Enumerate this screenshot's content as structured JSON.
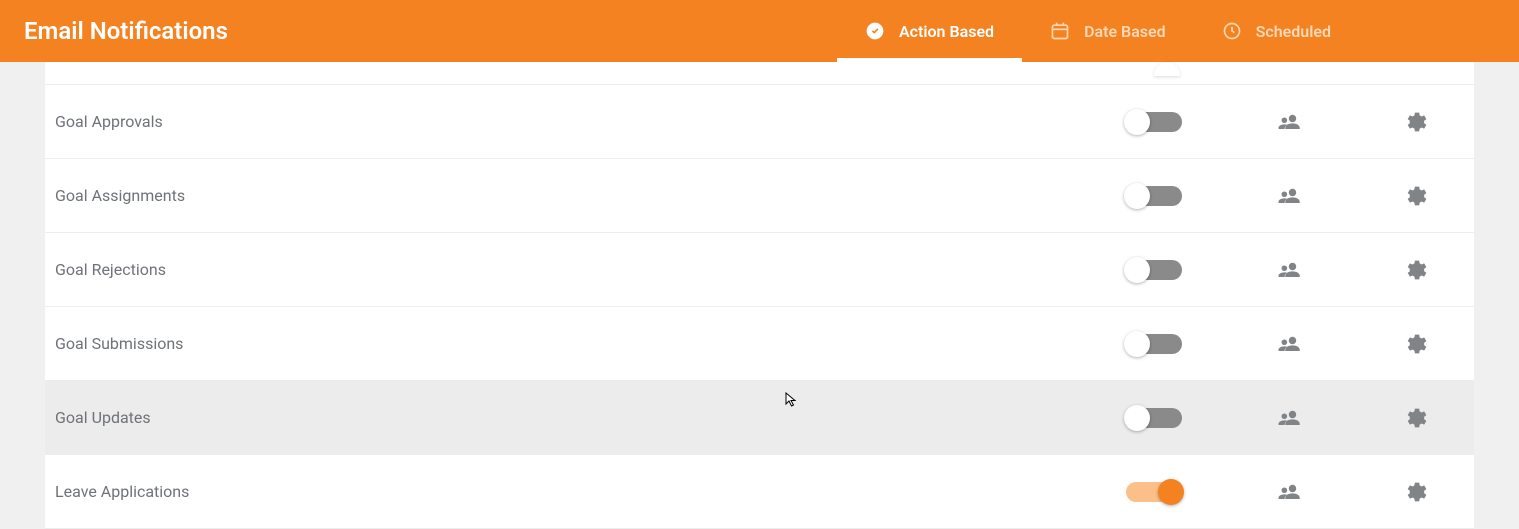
{
  "header": {
    "title": "Email Notifications"
  },
  "tabs": [
    {
      "label": "Action Based",
      "icon": "check-circle",
      "active": true
    },
    {
      "label": "Date Based",
      "icon": "calendar",
      "active": false
    },
    {
      "label": "Scheduled",
      "icon": "clock",
      "active": false
    }
  ],
  "rows": [
    {
      "label": "Goal Approvals",
      "enabled": false,
      "hovered": false
    },
    {
      "label": "Goal Assignments",
      "enabled": false,
      "hovered": false
    },
    {
      "label": "Goal Rejections",
      "enabled": false,
      "hovered": false
    },
    {
      "label": "Goal Submissions",
      "enabled": false,
      "hovered": false
    },
    {
      "label": "Goal Updates",
      "enabled": false,
      "hovered": true
    },
    {
      "label": "Leave Applications",
      "enabled": true,
      "hovered": false
    }
  ]
}
